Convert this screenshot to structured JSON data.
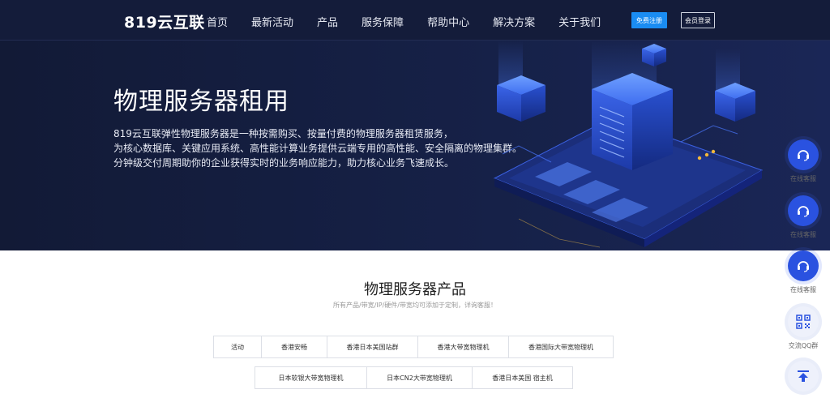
{
  "nav": {
    "logo": "819云互联",
    "links": [
      "首页",
      "最新活动",
      "产品",
      "服务保障",
      "帮助中心",
      "解决方案",
      "关于我们"
    ],
    "register": "免费注册",
    "login": "会员登录"
  },
  "hero": {
    "title": "物理服务器租用",
    "desc": [
      "819云互联弹性物理服务器是一种按需购买、按量付费的物理服务器租赁服务，",
      "为核心数据库、关键应用系统、高性能计算业务提供云端专用的高性能、安全隔离的物理集群。",
      "分钟级交付周期助你的企业获得实时的业务响应能力，助力核心业务飞速成长。"
    ]
  },
  "products": {
    "title": "物理服务器产品",
    "subtitle": "所有产品/带宽/IP/硬件/带宽均可添加于定制，详询客服！",
    "tabs_row1": [
      "活动",
      "香港安畅",
      "香港日本美国站群",
      "香港大带宽物理机",
      "香港国际大带宽物理机"
    ],
    "tabs_row2": [
      "日本软银大带宽物理机",
      "日本CN2大带宽物理机",
      "香港日本美国 宿主机"
    ]
  },
  "side": {
    "items": [
      {
        "label": "在线客服",
        "icon": "headset-icon"
      },
      {
        "label": "在线客服",
        "icon": "headset-icon"
      },
      {
        "label": "在线客服",
        "icon": "headset-icon"
      },
      {
        "label": "交流QQ群",
        "icon": "qr-code-icon"
      },
      {
        "label": "",
        "icon": "back-to-top-icon"
      }
    ]
  },
  "colors": {
    "nav_bg": "#141c3a",
    "hero_bg": "#162148",
    "accent": "#1a8cf2",
    "side_circle": "#2a52e0"
  }
}
